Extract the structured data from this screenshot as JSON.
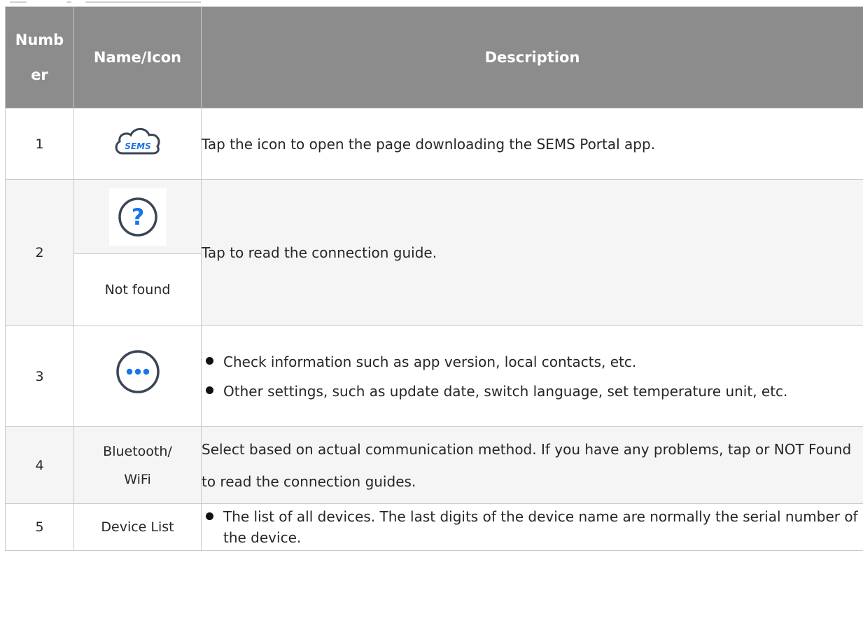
{
  "header": {
    "col_number": "Number",
    "col_name": "Name/Icon",
    "col_description": "Description"
  },
  "rows": [
    {
      "number": "1",
      "icon": "sems-cloud-icon",
      "icon_text": "SEMS",
      "description": "Tap the icon to open the page downloading the SEMS Portal app."
    },
    {
      "number": "2",
      "icon": "help-question-icon",
      "icon_text": "?",
      "name": "Not found",
      "description": "Tap to read the connection guide."
    },
    {
      "number": "3",
      "icon": "more-options-icon",
      "bullets": [
        "Check information such as app version, local contacts, etc.",
        "Other settings, such as update date, switch language, set temperature unit, etc."
      ]
    },
    {
      "number": "4",
      "name": "Bluetooth/ WiFi",
      "description": "Select based on actual communication method. If you have any problems, tap or NOT Found to read the connection guides."
    },
    {
      "number": "5",
      "name": "Device List",
      "bullets": [
        "The list of all devices. The last digits of the device name are normally the serial number of the device."
      ]
    }
  ],
  "colors": {
    "header_bg": "#8c8c8c",
    "alt_row_bg": "#f5f5f5",
    "border": "#c9c9c9",
    "icon_blue": "#1a73e8",
    "icon_dark": "#3a4656"
  }
}
